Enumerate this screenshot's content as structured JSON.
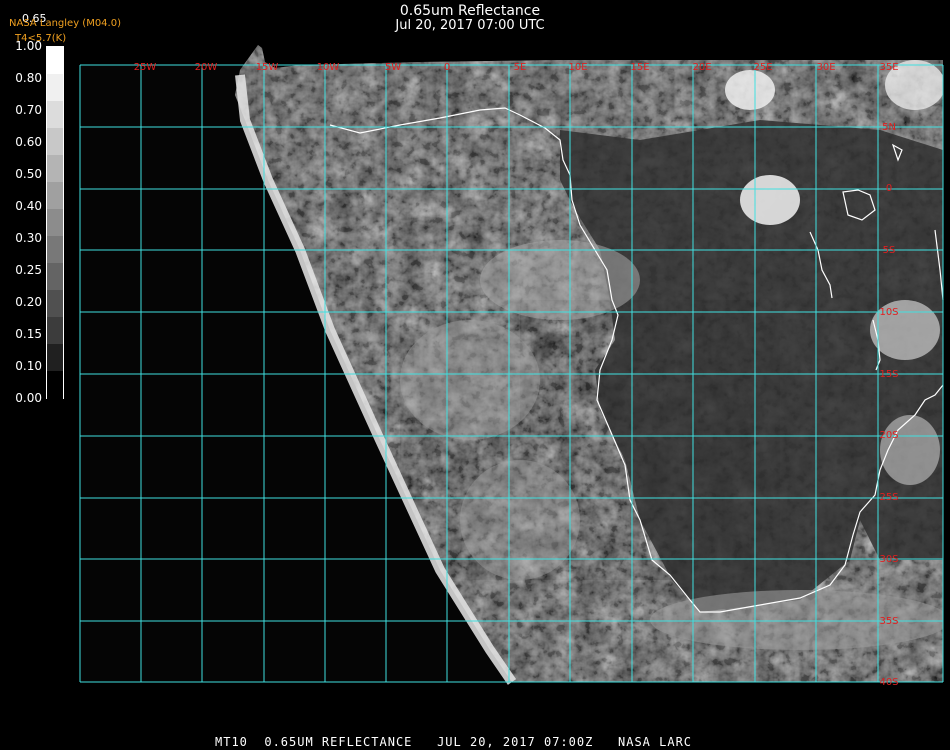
{
  "header": {
    "title": "0.65um Reflectance",
    "subtitle": "Jul 20, 2017 07:00 UTC",
    "value_label": "0.65",
    "source": "NASA Langley (M04.0)",
    "threshold": "T4<5.7(K)"
  },
  "colorbar": {
    "labels": [
      "1.00",
      "0.80",
      "0.70",
      "0.60",
      "0.50",
      "0.40",
      "0.30",
      "0.25",
      "0.20",
      "0.15",
      "0.10",
      "0.00"
    ],
    "colors": [
      "#ffffff",
      "#f0f0f0",
      "#dcdcdc",
      "#c8c8c8",
      "#b4b4b4",
      "#a0a0a0",
      "#8c8c8c",
      "#787878",
      "#646464",
      "#505050",
      "#3c3c3c",
      "#202020",
      "#000000"
    ]
  },
  "grid": {
    "lon_labels": [
      "25W",
      "20W",
      "15W",
      "10W",
      "5W",
      "0",
      "5E",
      "10E",
      "15E",
      "20E",
      "25E",
      "30E",
      "35E"
    ],
    "lat_labels": [
      "5N",
      "0",
      "5S",
      "10S",
      "15S",
      "20S",
      "25S",
      "30S",
      "35S",
      "40S"
    ],
    "line_color": "#40e0e0",
    "label_color": "#e02020"
  },
  "footer": {
    "text": "MT10  0.65UM REFLECTANCE   JUL 20, 2017 07:00Z   NASA LARC"
  }
}
